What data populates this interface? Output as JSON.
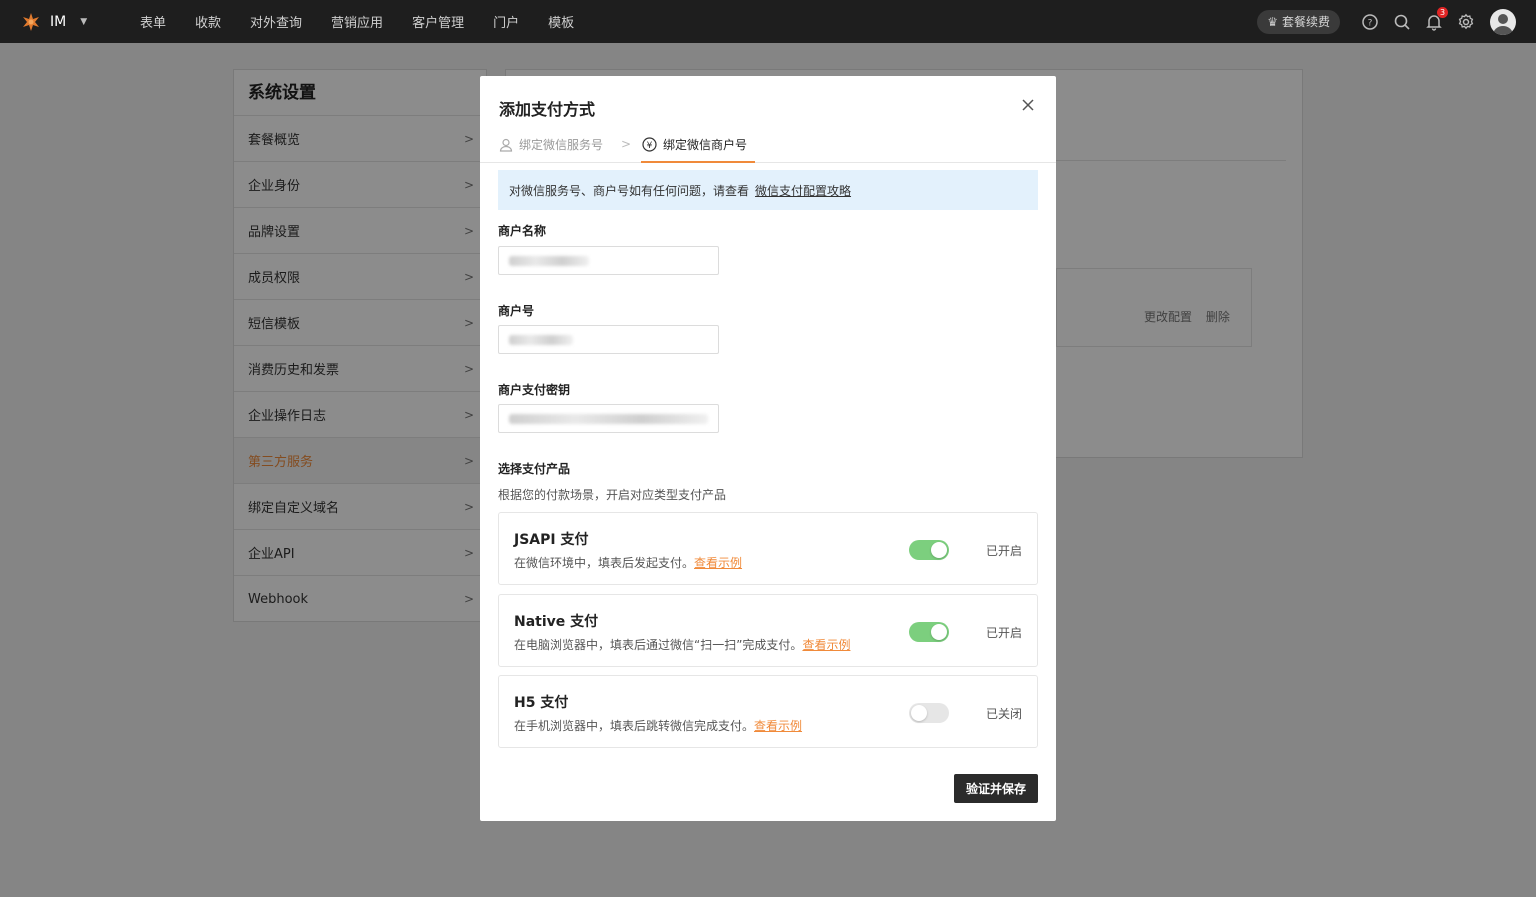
{
  "topbar": {
    "app_name": "IM",
    "nav": [
      "表单",
      "收款",
      "对外查询",
      "营销应用",
      "客户管理",
      "门户",
      "模板"
    ],
    "renew_label": "套餐续费",
    "notification_count": "3"
  },
  "settings": {
    "title": "系统设置",
    "items": [
      "套餐概览",
      "企业身份",
      "品牌设置",
      "成员权限",
      "短信模板",
      "消费历史和发票",
      "企业操作日志",
      "第三方服务",
      "绑定自定义域名",
      "企业API",
      "Webhook"
    ],
    "active_item": "第三方服务"
  },
  "content": {
    "actions": [
      "更改配置",
      "删除"
    ]
  },
  "modal": {
    "title": "添加支付方式",
    "steps": [
      "绑定微信服务号",
      "绑定微信商户号"
    ],
    "notice_text": "对微信服务号、商户号如有任何问题，请查看",
    "notice_link": "微信支付配置攻略",
    "fields": {
      "merchant_name_label": "商户名称",
      "merchant_id_label": "商户号",
      "merchant_key_label": "商户支付密钥"
    },
    "products_title": "选择支付产品",
    "products_sub": "根据您的付款场景，开启对应类型支付产品",
    "products": [
      {
        "name": "JSAPI 支付",
        "desc": "在微信环境中，填表后发起支付。",
        "link": "查看示例",
        "state": "已开启",
        "enabled": true
      },
      {
        "name": "Native 支付",
        "desc": "在电脑浏览器中，填表后通过微信“扫一扫”完成支付。",
        "link": "查看示例",
        "state": "已开启",
        "enabled": true
      },
      {
        "name": "H5 支付",
        "desc": "在手机浏览器中，填表后跳转微信完成支付。",
        "link": "查看示例",
        "state": "已关闭",
        "enabled": false
      }
    ],
    "save_label": "验证并保存"
  },
  "colors": {
    "accent": "#f08a3a",
    "toggle_on": "#7ccf7e",
    "toggle_off": "#e6e6e6",
    "topbar_bg": "#1e1e1e",
    "notice_bg": "#e3f1fc",
    "primary_button": "#2b2b2b"
  },
  "icons": [
    "logo-icon",
    "chevron-down-icon",
    "crown-icon",
    "help-icon",
    "search-icon",
    "bell-icon",
    "gear-icon",
    "user-icon",
    "yuan-icon",
    "close-icon",
    "chevron-right-icon"
  ]
}
